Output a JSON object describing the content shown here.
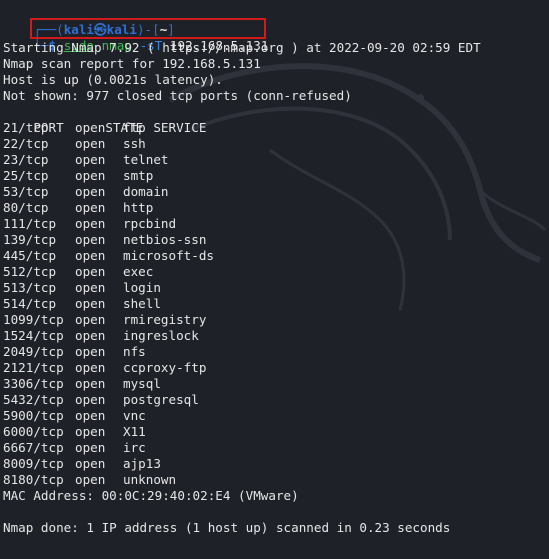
{
  "prompt": {
    "top_frame_left": "┌──(",
    "user_host": "kali㉿kali",
    "top_frame_mid": ")-[",
    "cwd": "~",
    "top_frame_right": "]",
    "bottom_frame": "└─",
    "dollar": "$ "
  },
  "command": {
    "sudo": "sudo",
    "nmap": "nmap",
    "flag": "-sT",
    "target": "192.168.5.131"
  },
  "output": {
    "starting": "Starting Nmap 7.92 ( https://nmap.org ) at 2022-09-20 02:59 EDT",
    "scan_report": "Nmap scan report for 192.168.5.131",
    "host_up": "Host is up (0.0021s latency).",
    "not_shown": "Not shown: 977 closed tcp ports (conn-refused)",
    "header": {
      "port": "PORT",
      "state": "STATE",
      "service": "SERVICE"
    },
    "ports": [
      {
        "port": "21/tcp",
        "state": "open",
        "service": "ftp"
      },
      {
        "port": "22/tcp",
        "state": "open",
        "service": "ssh"
      },
      {
        "port": "23/tcp",
        "state": "open",
        "service": "telnet"
      },
      {
        "port": "25/tcp",
        "state": "open",
        "service": "smtp"
      },
      {
        "port": "53/tcp",
        "state": "open",
        "service": "domain"
      },
      {
        "port": "80/tcp",
        "state": "open",
        "service": "http"
      },
      {
        "port": "111/tcp",
        "state": "open",
        "service": "rpcbind"
      },
      {
        "port": "139/tcp",
        "state": "open",
        "service": "netbios-ssn"
      },
      {
        "port": "445/tcp",
        "state": "open",
        "service": "microsoft-ds"
      },
      {
        "port": "512/tcp",
        "state": "open",
        "service": "exec"
      },
      {
        "port": "513/tcp",
        "state": "open",
        "service": "login"
      },
      {
        "port": "514/tcp",
        "state": "open",
        "service": "shell"
      },
      {
        "port": "1099/tcp",
        "state": "open",
        "service": "rmiregistry"
      },
      {
        "port": "1524/tcp",
        "state": "open",
        "service": "ingreslock"
      },
      {
        "port": "2049/tcp",
        "state": "open",
        "service": "nfs"
      },
      {
        "port": "2121/tcp",
        "state": "open",
        "service": "ccproxy-ftp"
      },
      {
        "port": "3306/tcp",
        "state": "open",
        "service": "mysql"
      },
      {
        "port": "5432/tcp",
        "state": "open",
        "service": "postgresql"
      },
      {
        "port": "5900/tcp",
        "state": "open",
        "service": "vnc"
      },
      {
        "port": "6000/tcp",
        "state": "open",
        "service": "X11"
      },
      {
        "port": "6667/tcp",
        "state": "open",
        "service": "irc"
      },
      {
        "port": "8009/tcp",
        "state": "open",
        "service": "ajp13"
      },
      {
        "port": "8180/tcp",
        "state": "open",
        "service": "unknown"
      }
    ],
    "mac": "MAC Address: 00:0C:29:40:02:E4 (VMware)",
    "done": "Nmap done: 1 IP address (1 host up) scanned in 0.23 seconds"
  },
  "colors": {
    "background": "#1f2129",
    "prompt_blue": "#2f6fd1",
    "command_green": "#3fb950",
    "highlight_red": "#d11a1a"
  }
}
